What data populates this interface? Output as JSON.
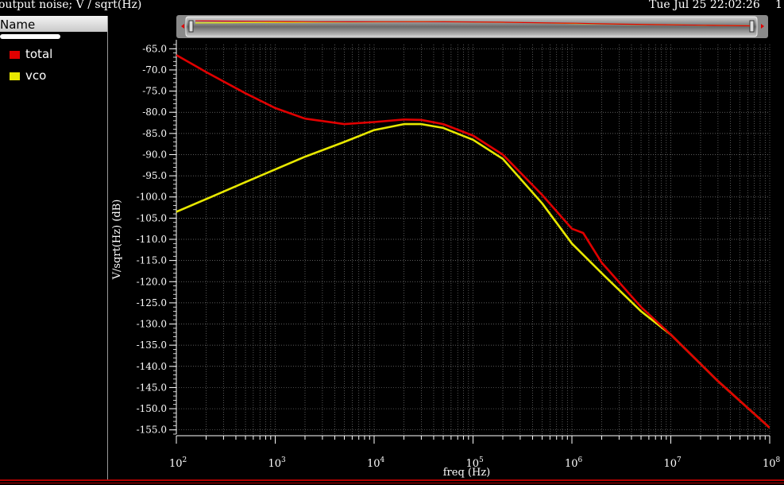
{
  "header": {
    "title": "output noise; V / sqrt(Hz)",
    "datetime": "Tue Jul 25 22:02:26",
    "corner": "1"
  },
  "legend": {
    "header": "Name",
    "items": [
      {
        "label": "total",
        "color": "#e00000"
      },
      {
        "label": "vco",
        "color": "#e8e800"
      }
    ]
  },
  "colors": {
    "background": "#000000",
    "grid": "#7a7a7a",
    "total": "#e00000",
    "vco": "#e8e800"
  },
  "chart_data": {
    "type": "line",
    "xlabel": "freq (Hz)",
    "ylabel": "V/sqrt(Hz)  (dB)",
    "xscale": "log",
    "xlim": [
      100,
      100000000
    ],
    "ylim": [
      -156,
      -64
    ],
    "x_ticks": [
      {
        "base": "10",
        "exp": "2"
      },
      {
        "base": "10",
        "exp": "3"
      },
      {
        "base": "10",
        "exp": "4"
      },
      {
        "base": "10",
        "exp": "5"
      },
      {
        "base": "10",
        "exp": "6"
      },
      {
        "base": "10",
        "exp": "7"
      },
      {
        "base": "10",
        "exp": "8"
      }
    ],
    "y_ticks": [
      "-65.0",
      "-70.0",
      "-75.0",
      "-80.0",
      "-85.0",
      "-90.0",
      "-95.0",
      "-100.0",
      "-105.0",
      "-110.0",
      "-115.0",
      "-120.0",
      "-125.0",
      "-130.0",
      "-135.0",
      "-140.0",
      "-145.0",
      "-150.0",
      "-155.0"
    ],
    "grid": true,
    "series": [
      {
        "name": "total",
        "color": "#e00000",
        "x": [
          100,
          200,
          500,
          1000,
          2000,
          5000,
          10000,
          20000,
          30000,
          50000,
          100000,
          200000,
          500000,
          1000000,
          1300000,
          2000000,
          5000000,
          10000000,
          30000000,
          100000000
        ],
        "y": [
          -66.5,
          -70.5,
          -75.5,
          -79,
          -81.5,
          -82.8,
          -82.3,
          -81.7,
          -81.8,
          -82.8,
          -85.5,
          -90,
          -99.5,
          -107.5,
          -108.5,
          -115.5,
          -126,
          -132.5,
          -143.5,
          -154.5
        ]
      },
      {
        "name": "vco",
        "color": "#e8e800",
        "x": [
          100,
          200,
          500,
          1000,
          2000,
          5000,
          10000,
          20000,
          30000,
          50000,
          100000,
          200000,
          500000,
          1000000,
          2000000,
          5000000,
          10000000,
          30000000,
          100000000
        ],
        "y": [
          -103.5,
          -100.5,
          -96.5,
          -93.5,
          -90.5,
          -87,
          -84.2,
          -82.8,
          -82.8,
          -83.7,
          -86.5,
          -91,
          -101.5,
          -111,
          -118,
          -127,
          -132.5,
          -143.5,
          -154.5
        ]
      }
    ]
  }
}
